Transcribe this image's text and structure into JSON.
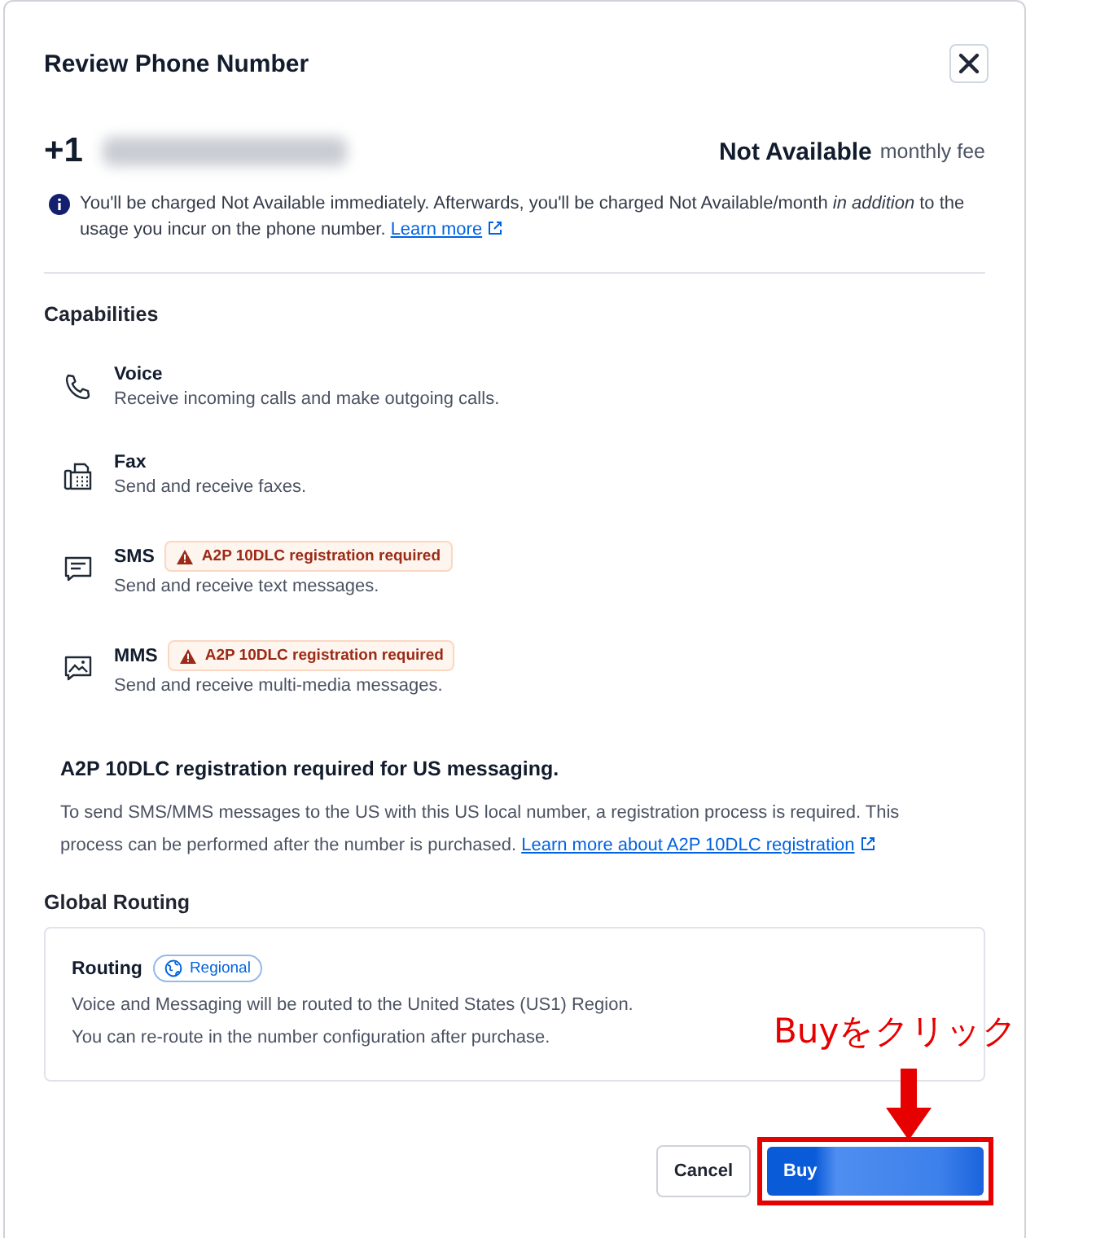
{
  "dialog": {
    "title": "Review Phone Number"
  },
  "number": {
    "prefix": "+1",
    "fee": "Not Available",
    "fee_unit": "monthly fee"
  },
  "notice": {
    "text": "You'll be charged Not Available immediately. Afterwards, you'll be charged Not Available/month *in addition* to the usage you incur on the phone number.",
    "link": "Learn more"
  },
  "capabilities": {
    "heading": "Capabilities",
    "items": [
      {
        "kind": "voice",
        "name": "Voice",
        "description": "Receive incoming calls and make outgoing calls."
      },
      {
        "kind": "fax",
        "name": "Fax",
        "description": "Send and receive faxes."
      },
      {
        "kind": "sms",
        "name": "SMS",
        "badge": "A2P 10DLC registration required",
        "description": "Send and receive text messages."
      },
      {
        "kind": "mms",
        "name": "MMS",
        "badge": "A2P 10DLC registration required",
        "description": "Send and receive multi-media messages."
      }
    ]
  },
  "a2p": {
    "heading": "A2P 10DLC registration required for US messaging.",
    "text": "To send SMS/MMS messages to the US with this US local number, a registration process is required. This process can be performed after the number is purchased.",
    "link": "Learn more about A2P 10DLC registration"
  },
  "routing": {
    "heading": "Global Routing",
    "title": "Routing",
    "tag": "Regional",
    "lines": [
      "Voice and Messaging will be routed to the United States (US1) Region.",
      "You can re-route in the number configuration after purchase."
    ]
  },
  "buttons": {
    "cancel": "Cancel",
    "buy": "Buy"
  },
  "annotation": {
    "text": "Buyをクリック"
  }
}
